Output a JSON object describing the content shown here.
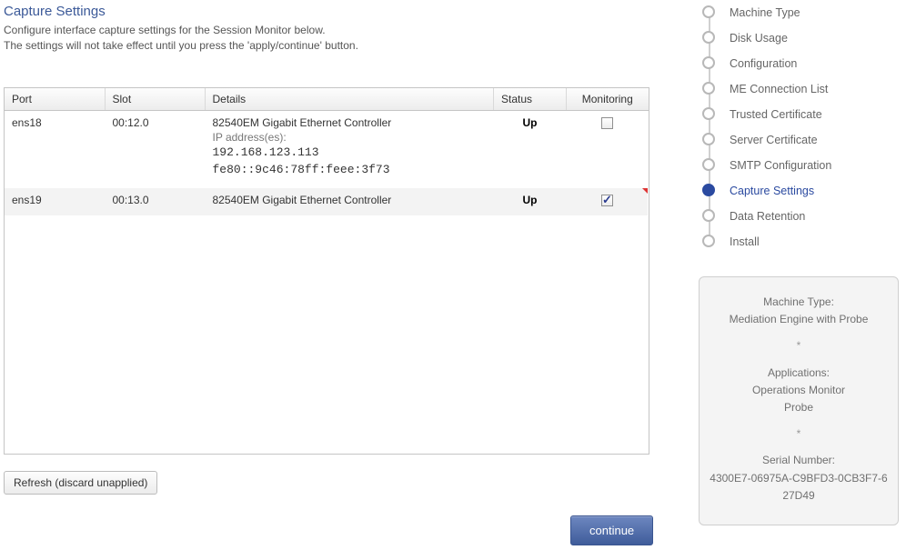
{
  "page": {
    "title": "Capture Settings",
    "subtitle_line1": "Configure interface capture settings for the Session Monitor below.",
    "subtitle_line2": "The settings will not take effect until you press the 'apply/continue' button."
  },
  "grid": {
    "headers": {
      "port": "Port",
      "slot": "Slot",
      "details": "Details",
      "status": "Status",
      "monitoring": "Monitoring"
    },
    "rows": [
      {
        "port": "ens18",
        "slot": "00:12.0",
        "details_main": "82540EM Gigabit Ethernet Controller",
        "details_sub": "IP address(es):",
        "ips": [
          "192.168.123.113",
          "fe80::9c46:78ff:feee:3f73"
        ],
        "status": "Up",
        "monitoring_checked": false,
        "selected": false
      },
      {
        "port": "ens19",
        "slot": "00:13.0",
        "details_main": "82540EM Gigabit Ethernet Controller",
        "details_sub": "",
        "ips": [],
        "status": "Up",
        "monitoring_checked": true,
        "selected": true
      }
    ]
  },
  "buttons": {
    "refresh": "Refresh (discard unapplied)",
    "continue": "continue"
  },
  "sidebar": {
    "steps": [
      {
        "label": "Machine Type",
        "current": false
      },
      {
        "label": "Disk Usage",
        "current": false
      },
      {
        "label": "Configuration",
        "current": false
      },
      {
        "label": "ME Connection List",
        "current": false
      },
      {
        "label": "Trusted Certificate",
        "current": false
      },
      {
        "label": "Server Certificate",
        "current": false
      },
      {
        "label": "SMTP Configuration",
        "current": false
      },
      {
        "label": "Capture Settings",
        "current": true
      },
      {
        "label": "Data Retention",
        "current": false
      },
      {
        "label": "Install",
        "current": false
      }
    ],
    "info": {
      "machine_type_label": "Machine Type:",
      "machine_type_value": "Mediation Engine with Probe",
      "applications_label": "Applications:",
      "applications_values": [
        "Operations Monitor",
        "Probe"
      ],
      "serial_label": "Serial Number:",
      "serial_value": "4300E7-06975A-C9BFD3-0CB3F7-627D49",
      "separator": "*"
    }
  }
}
